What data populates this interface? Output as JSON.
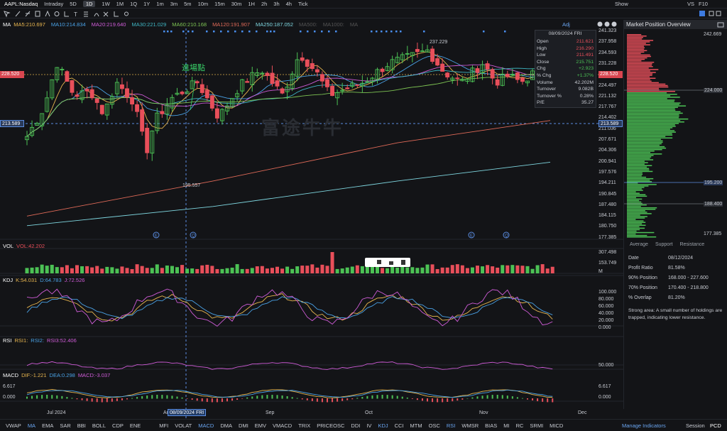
{
  "toolbar": {
    "symbol": "AAPL:Nasdaq",
    "periods": [
      "Intraday",
      "5D",
      "1D",
      "1W",
      "1M",
      "1Q",
      "1Y",
      "1m",
      "3m",
      "5m",
      "10m",
      "15m",
      "30m",
      "1H",
      "2h",
      "3h",
      "4h",
      "Tick"
    ],
    "active": "1D",
    "right": [
      "Show",
      "VS",
      "F10"
    ]
  },
  "ma_legend": {
    "label": "MA",
    "items": [
      {
        "t": "MA5:210.697",
        "c": "#e8b64f"
      },
      {
        "t": "MA10:214.834",
        "c": "#4aa2e6"
      },
      {
        "t": "MA20:219.640",
        "c": "#d05cd8"
      },
      {
        "t": "MA30:221.029",
        "c": "#3fb7c4"
      },
      {
        "t": "MA60:210.168",
        "c": "#7ec453"
      },
      {
        "t": "MA120:191.907",
        "c": "#e06a58"
      },
      {
        "t": "MA250:187.052",
        "c": "#7fd7e0"
      },
      {
        "t": "MA500:",
        "c": "#555"
      },
      {
        "t": "MA1000:",
        "c": "#555"
      },
      {
        "t": "MA",
        "c": "#555"
      }
    ]
  },
  "price_axis": [
    "241.323",
    "237.958",
    "234.593",
    "231.228",
    "227.862",
    "224.497",
    "221.132",
    "217.767",
    "214.402",
    "211.036",
    "207.671",
    "204.306",
    "200.941",
    "197.576",
    "194.211",
    "190.845",
    "187.480",
    "184.115",
    "180.750",
    "177.385"
  ],
  "price_tags": {
    "top": "228.520",
    "mid": "213.589"
  },
  "annotations": {
    "entry": "進場點",
    "high": "237.229",
    "low": "195.557",
    "watermark": "富途牛牛",
    "adj": "Adj"
  },
  "tooltip": {
    "date": "08/09/2024 FRI",
    "rows": [
      {
        "k": "Open",
        "v": "211.621",
        "c": "#e84f5a"
      },
      {
        "k": "High",
        "v": "216.290",
        "c": "#e84f5a"
      },
      {
        "k": "Low",
        "v": "211.491",
        "c": "#e84f5a"
      },
      {
        "k": "Close",
        "v": "215.751",
        "c": "#4cc255"
      },
      {
        "k": "Chg",
        "v": "+2.923",
        "c": "#4cc255"
      },
      {
        "k": "% Chg",
        "v": "+1.37%",
        "c": "#4cc255"
      },
      {
        "k": "Volume",
        "v": "42.202M",
        "c": "#c9ccd3"
      },
      {
        "k": "Turnover",
        "v": "9.082B",
        "c": "#c9ccd3"
      },
      {
        "k": "Turnover %",
        "v": "0.28%",
        "c": "#c9ccd3"
      },
      {
        "k": "P/E",
        "v": "35.27",
        "c": "#c9ccd3"
      }
    ]
  },
  "vol": {
    "label": "VOL",
    "value": "VOL:42.202",
    "axis": [
      "307.498",
      "153.749",
      "M"
    ]
  },
  "kdj": {
    "label": "KDJ",
    "k": "K:54.031",
    "d": "D:64.783",
    "j": "J:72.526",
    "axis": [
      "100.000",
      "80.000",
      "60.000",
      "40.000",
      "20.000",
      "0.000"
    ]
  },
  "rsi": {
    "label": "RSI",
    "r1": "RSI1:",
    "r2": "RSI2:",
    "r3": "RSI3:52.406",
    "axis": [
      "50.000"
    ]
  },
  "macd": {
    "label": "MACD",
    "dif": "DIF:-1.221",
    "dea": "DEA:0.298",
    "macd": "MACD:-3.037",
    "axis": [
      "6.617",
      "0.000"
    ]
  },
  "xaxis": {
    "labels": [
      "Jul 2024",
      "Aug",
      "Sep",
      "Oct",
      "Nov",
      "Dec"
    ],
    "cursor": "08/09/2024 FRI"
  },
  "mpo": {
    "title": "Market Position Overview",
    "top": "242.669",
    "bottom": "177.385",
    "levels": [
      "224.000",
      "195.200",
      "188.400"
    ],
    "legend": [
      "Average",
      "Support",
      "Resistance"
    ],
    "stats": [
      {
        "k": "Date",
        "v": "08/12/2024"
      },
      {
        "k": "Profit Ratio",
        "v": "81.58%"
      },
      {
        "k": "90% Position",
        "v": "168.000 - 227.600"
      },
      {
        "k": "70% Position",
        "v": "170.400 - 218.800"
      },
      {
        "k": "% Overlap",
        "v": "81.20%"
      }
    ],
    "note": "Strong area: A small number of holdings are trapped, indicating lower resistance."
  },
  "bottom_tabs": [
    "VWAP",
    "MA",
    "EMA",
    "SAR",
    "BBI",
    "BOLL",
    "CDP",
    "ENE",
    "",
    "MFI",
    "VOLAT",
    "MACD",
    "DMA",
    "DMI",
    "EMV",
    "VMACD",
    "TRIX",
    "PRICEOSC",
    "DDI",
    "IV",
    "KDJ",
    "CCI",
    "MTM",
    "OSC",
    "RSI",
    "WMSR",
    "BIAS",
    "MI",
    "RC",
    "SRMI",
    "MICD"
  ],
  "bottom_active": [
    "MA",
    "MACD",
    "KDJ",
    "RSI"
  ],
  "bottom_right": [
    "Manage Indicators",
    "Session",
    "PCD"
  ],
  "colors": {
    "up": "#4cc255",
    "down": "#e84f5a",
    "bg": "#131417"
  }
}
